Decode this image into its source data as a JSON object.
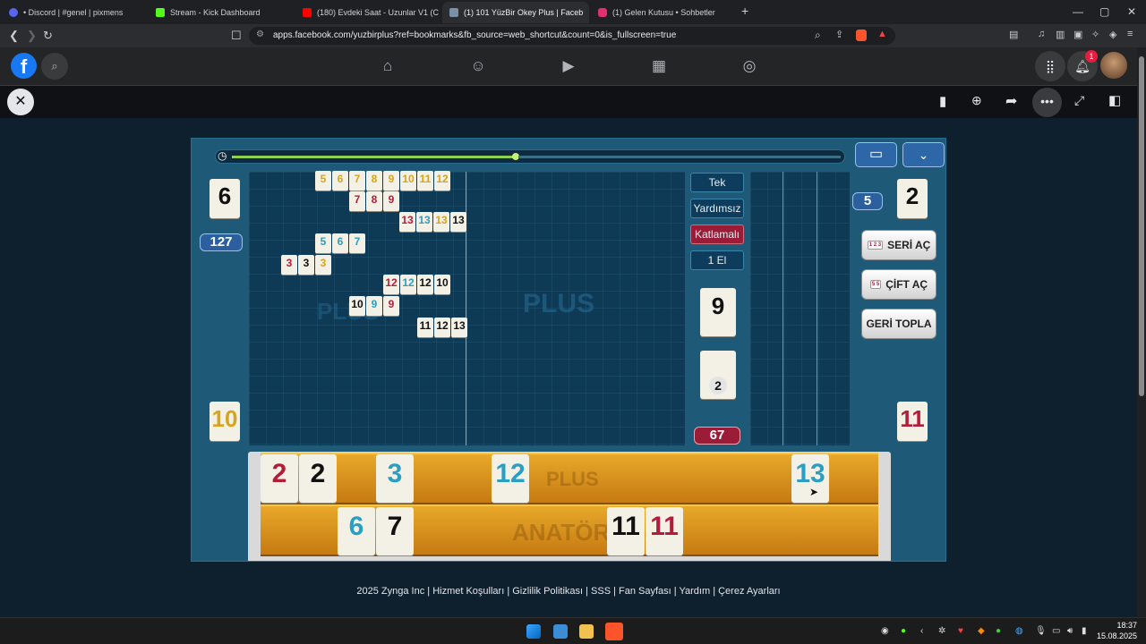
{
  "browser": {
    "tabs": [
      {
        "label": "• Discord | #genel | pixmens",
        "color": "#5865f2"
      },
      {
        "label": "Stream - Kick Dashboard",
        "color": "#53fc18"
      },
      {
        "label": "(180) Evdeki Saat - Uzunlar V1 (C",
        "color": "#ff0000"
      },
      {
        "label": "(1) 101 YüzBir Okey Plus | Faceb",
        "color": "#7b8fa6"
      },
      {
        "label": "(1) Gelen Kutusu • Sohbetler",
        "color": "#e1306c"
      }
    ],
    "new_tab": "+",
    "url": "apps.facebook.com/yuzbirplus?ref=bookmarks&fb_source=web_shortcut&count=0&is_fullscreen=true",
    "minimize": "—",
    "maximize": "▢",
    "close": "✕"
  },
  "facebook": {
    "logo": "f",
    "notification_count": "1"
  },
  "game": {
    "left_player_count": "6",
    "score_badge": "127",
    "right_player_count": "2",
    "right_badge": "5",
    "modes": [
      "Tek",
      "Yardımsız",
      "Katlamalı",
      "1 El"
    ],
    "selected_mode": "Katlamalı",
    "indicator_tile": "9",
    "deck_count": "2",
    "remaining_badge": "67",
    "buttons": {
      "seri": "SERİ AÇ",
      "cift": "ÇİFT AÇ",
      "geri": "GERİ TOPLA"
    },
    "left_discard": "10",
    "right_discard": "11",
    "table_melds": [
      [
        {
          "v": "5",
          "c": "y"
        },
        {
          "v": "6",
          "c": "y"
        },
        {
          "v": "7",
          "c": "y"
        },
        {
          "v": "8",
          "c": "y"
        },
        {
          "v": "9",
          "c": "y"
        },
        {
          "v": "10",
          "c": "y"
        },
        {
          "v": "11",
          "c": "y"
        },
        {
          "v": "12",
          "c": "y"
        }
      ],
      [
        {
          "v": "7",
          "c": "r"
        },
        {
          "v": "8",
          "c": "r"
        },
        {
          "v": "9",
          "c": "r"
        }
      ],
      [
        {
          "v": "13",
          "c": "r"
        },
        {
          "v": "13",
          "c": "b"
        },
        {
          "v": "13",
          "c": "y"
        },
        {
          "v": "13",
          "c": "k"
        }
      ],
      [
        {
          "v": "5",
          "c": "b"
        },
        {
          "v": "6",
          "c": "b"
        },
        {
          "v": "7",
          "c": "b"
        }
      ],
      [
        {
          "v": "3",
          "c": "r"
        },
        {
          "v": "3",
          "c": "k"
        },
        {
          "v": "3",
          "c": "y"
        }
      ],
      [
        {
          "v": "12",
          "c": "r"
        },
        {
          "v": "12",
          "c": "b"
        },
        {
          "v": "12",
          "c": "k"
        },
        {
          "v": "10",
          "c": "k"
        }
      ],
      [
        {
          "v": "10",
          "c": "k"
        },
        {
          "v": "9",
          "c": "b"
        },
        {
          "v": "9",
          "c": "r"
        }
      ],
      [
        {
          "v": "11",
          "c": "k"
        },
        {
          "v": "12",
          "c": "k"
        },
        {
          "v": "13",
          "c": "k"
        }
      ]
    ],
    "rack_top": [
      {
        "v": "2",
        "c": "r"
      },
      {
        "v": "2",
        "c": "k"
      },
      {
        "v": "3",
        "c": "b"
      },
      {
        "v": "12",
        "c": "b"
      },
      {
        "v": "13",
        "c": "b"
      }
    ],
    "rack_bottom": [
      {
        "v": "6",
        "c": "b"
      },
      {
        "v": "7",
        "c": "k"
      },
      {
        "v": "11",
        "c": "k"
      },
      {
        "v": "11",
        "c": "r"
      }
    ],
    "rack_watermark_top": "PLUS",
    "rack_watermark_bottom": "ANATÖRL",
    "board_watermark": "PLUS"
  },
  "footer": "2025 Zynga Inc | Hizmet Koşulları | Gizlilik Politikası | SSS | Fan Sayfası | Yardım | Çerez Ayarları",
  "taskbar": {
    "time": "18:37",
    "date": "15.08.2025"
  }
}
